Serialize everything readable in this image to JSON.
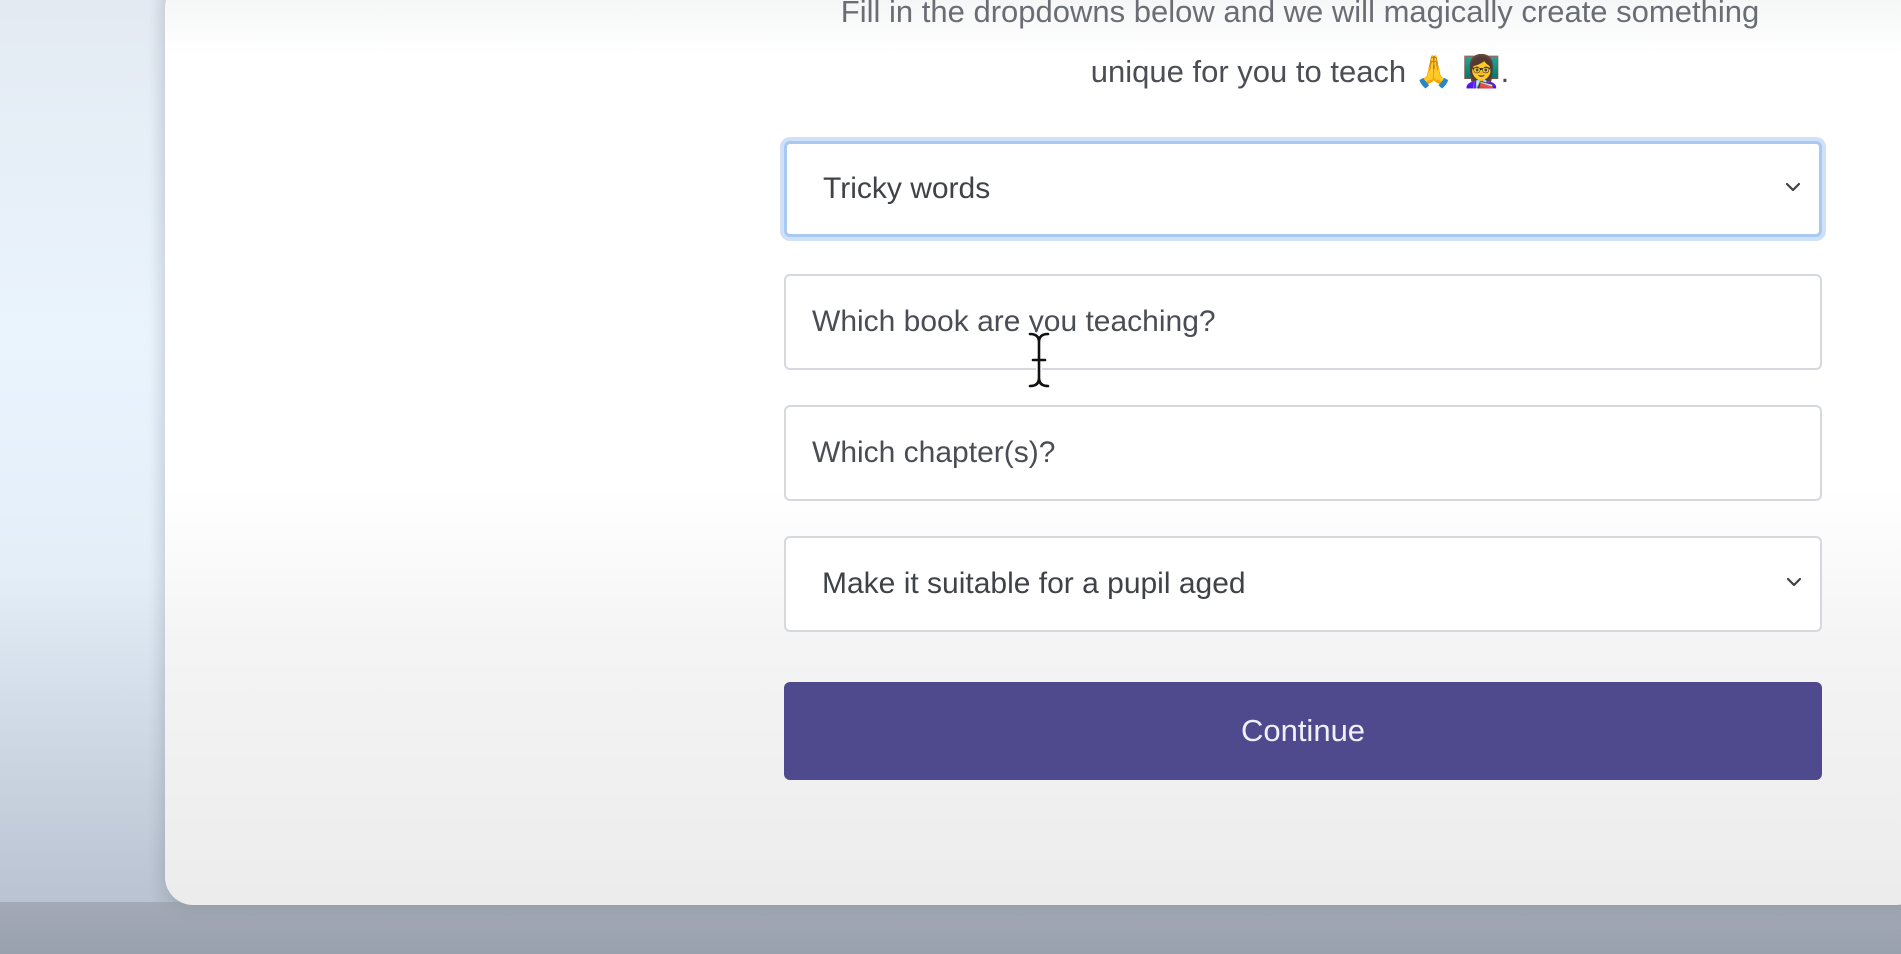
{
  "intro": {
    "line1": "Fill in the dropdowns below and we will magically create something",
    "line2": "unique for you to teach 🙏 👩‍🏫."
  },
  "form": {
    "topic_select": {
      "selected": "Tricky words",
      "icon": "chevron-down-icon"
    },
    "book_input": {
      "placeholder": "Which book are you teaching?",
      "value": ""
    },
    "chapter_input": {
      "placeholder": "Which chapter(s)?",
      "value": ""
    },
    "age_select": {
      "selected": "Make it suitable for a pupil aged",
      "icon": "chevron-down-icon"
    },
    "continue_label": "Continue"
  },
  "colors": {
    "button": "#4f4a8e",
    "focus_ring": "#a9c8f2"
  }
}
